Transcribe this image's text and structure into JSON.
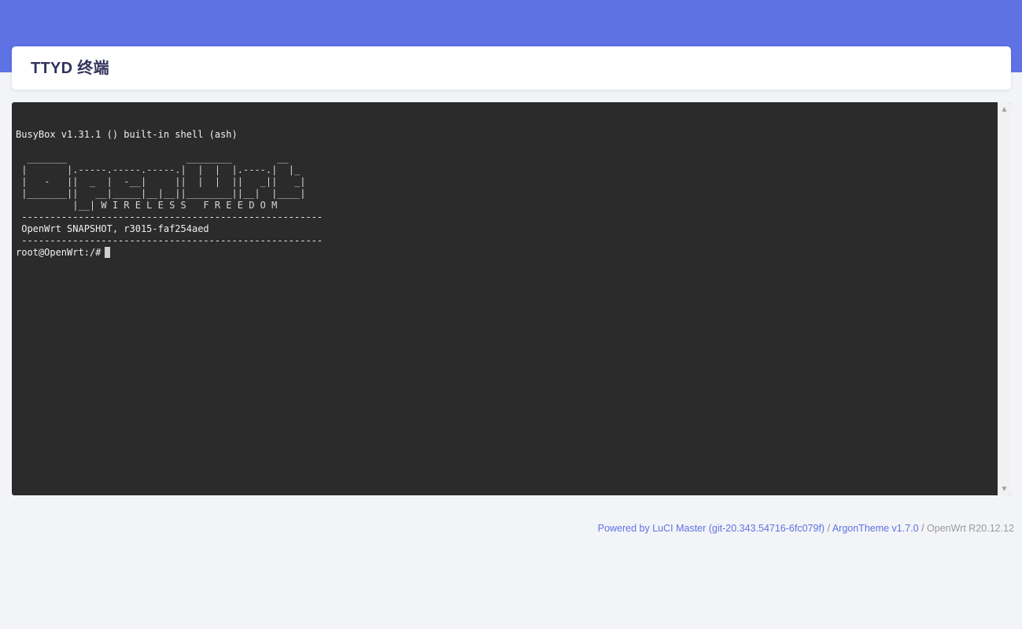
{
  "header": {
    "title": "TTYD 终端"
  },
  "terminal": {
    "lines": [
      "BusyBox v1.31.1 () built-in shell (ash)",
      "",
      "  _______                     ________        __",
      " |       |.-----.-----.-----.|  |  |  |.----.|  |_",
      " |   -   ||  _  |  -__|     ||  |  |  ||   _||   _|",
      " |_______||   __|_____|__|__||________||__|  |____|",
      "          |__| W I R E L E S S   F R E E D O M",
      " -----------------------------------------------------",
      " OpenWrt SNAPSHOT, r3015-faf254aed",
      " -----------------------------------------------------"
    ],
    "prompt": "root@OpenWrt:/#"
  },
  "scrollbar": {
    "up_icon": "triangle-up-icon",
    "down_icon": "triangle-down-icon"
  },
  "footer": {
    "powered_link": "Powered by LuCI Master (git-20.343.54716-6fc079f)",
    "sep1": " / ",
    "theme_link": "ArgonTheme v1.7.0",
    "sep2": " / ",
    "version": "OpenWrt R20.12.12"
  },
  "colors": {
    "accent": "#5e72e4",
    "page_bg": "#f3f4f7",
    "terminal_bg": "#2b2b2b",
    "title_text": "#32325d"
  }
}
